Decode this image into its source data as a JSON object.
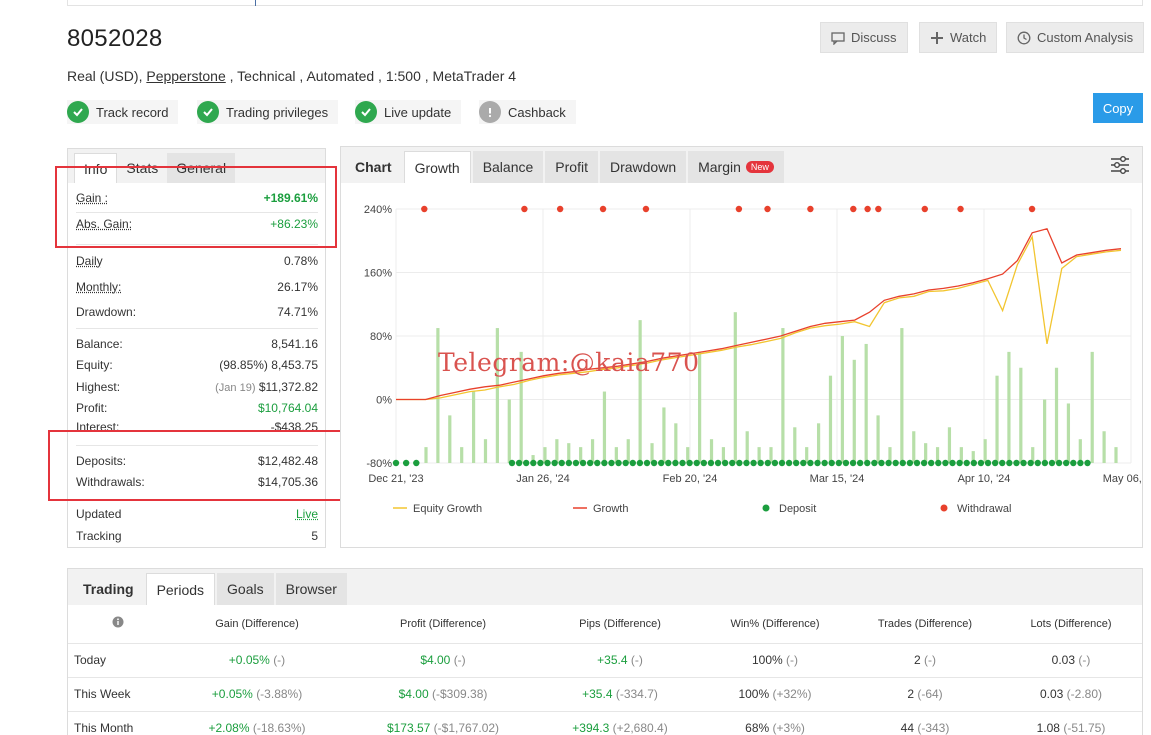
{
  "account": {
    "title": "8052028",
    "meta_prefix": "Real (USD), ",
    "broker": "Pepperstone",
    "meta_suffix": " , Technical , Automated , 1:500 , MetaTrader 4"
  },
  "header_buttons": {
    "discuss": "Discuss",
    "watch": "Watch",
    "custom_analysis": "Custom Analysis",
    "copy": "Copy"
  },
  "badges": [
    {
      "label": "Track record",
      "status": "verified"
    },
    {
      "label": "Trading privileges",
      "status": "verified"
    },
    {
      "label": "Live update",
      "status": "verified"
    },
    {
      "label": "Cashback",
      "status": "unverified"
    }
  ],
  "info_tabs": [
    "Info",
    "Stats",
    "General"
  ],
  "info": {
    "gain_label": "Gain :",
    "gain_value": "+189.61%",
    "abs_gain_label": "Abs. Gain:",
    "abs_gain_value": "+86.23%",
    "daily_label": "Daily",
    "daily_value": "0.78%",
    "monthly_label": "Monthly:",
    "monthly_value": "26.17%",
    "drawdown_label": "Drawdown:",
    "drawdown_value": "74.71%",
    "balance_label": "Balance:",
    "balance_value": "8,541.16",
    "equity_label": "Equity:",
    "equity_pct": "(98.85%)",
    "equity_value": "8,453.75",
    "highest_label": "Highest:",
    "highest_date": "(Jan 19)",
    "highest_value": "$11,372.82",
    "profit_label": "Profit:",
    "profit_value": "$10,764.04",
    "interest_label": "Interest:",
    "interest_value": "-$438.25",
    "deposits_label": "Deposits:",
    "deposits_value": "$12,482.48",
    "withdrawals_label": "Withdrawals:",
    "withdrawals_value": "$14,705.36",
    "updated_label": "Updated",
    "updated_value": "Live",
    "tracking_label": "Tracking",
    "tracking_value": "5"
  },
  "chart_tabs": {
    "label": "Chart",
    "items": [
      "Growth",
      "Balance",
      "Profit",
      "Drawdown",
      "Margin"
    ],
    "new_tag": "New"
  },
  "chart_data": {
    "type": "line",
    "x_tick_labels": [
      "Dec 21, '23",
      "Jan 26, '24",
      "Feb 20, '24",
      "Mar 15, '24",
      "Apr 10, '24",
      "May 06, '24"
    ],
    "y_tick_labels": [
      "240%",
      "160%",
      "80%",
      "0%",
      "-80%"
    ],
    "ylim": [
      -80,
      240
    ],
    "legend_position": "bottom",
    "legend": [
      "Equity Growth",
      "Growth",
      "Deposit",
      "Withdrawal"
    ],
    "colors": {
      "equity": "#f2c530",
      "growth": "#e8412c",
      "bars": "#b7dfa8",
      "deposit": "#1b9e3e",
      "withdrawal": "#e8412c"
    },
    "growth": [
      0,
      0,
      0,
      5,
      9,
      13,
      16,
      18,
      22,
      26,
      30,
      33,
      35,
      38,
      40,
      42,
      45,
      48,
      52,
      55,
      58,
      61,
      64,
      68,
      72,
      76,
      80,
      86,
      92,
      96,
      98,
      100,
      110,
      125,
      130,
      133,
      138,
      140,
      143,
      147,
      152,
      158,
      175,
      210,
      215,
      172,
      182,
      185,
      188,
      190
    ],
    "equity": [
      0,
      0,
      0,
      2,
      6,
      10,
      12,
      16,
      19,
      24,
      28,
      31,
      33,
      35,
      38,
      40,
      43,
      46,
      50,
      53,
      56,
      59,
      62,
      66,
      69,
      73,
      77,
      84,
      90,
      93,
      95,
      98,
      92,
      122,
      128,
      130,
      136,
      137,
      140,
      145,
      150,
      112,
      170,
      205,
      70,
      165,
      180,
      183,
      186,
      188
    ],
    "bars": [
      20,
      170,
      60,
      20,
      90,
      30,
      170,
      80,
      140,
      10,
      20,
      30,
      25,
      20,
      30,
      90,
      20,
      30,
      180,
      25,
      70,
      50,
      20,
      140,
      30,
      20,
      190,
      40,
      20,
      20,
      170,
      45,
      20,
      50,
      110,
      160,
      130,
      150,
      60,
      20,
      170,
      40,
      25,
      20,
      45,
      20,
      15,
      30,
      110,
      140,
      120,
      20,
      80,
      120,
      75,
      30,
      140,
      40,
      20
    ],
    "deposits_count": 85,
    "withdrawals_count": 14
  },
  "watermark": "Telegram:@kaia770",
  "periods": {
    "tabs": [
      "Trading",
      "Periods",
      "Goals",
      "Browser"
    ],
    "columns": [
      "Gain (Difference)",
      "Profit (Difference)",
      "Pips (Difference)",
      "Win% (Difference)",
      "Trades (Difference)",
      "Lots (Difference)"
    ],
    "rows": [
      {
        "label": "Today",
        "gain": "+0.05%",
        "gain_d": "(-)",
        "profit": "$4.00",
        "profit_d": "(-)",
        "pips": "+35.4",
        "pips_d": "(-)",
        "win": "100%",
        "win_d": "(-)",
        "trades": "2",
        "trades_d": "(-)",
        "lots": "0.03",
        "lots_d": "(-)"
      },
      {
        "label": "This Week",
        "gain": "+0.05%",
        "gain_d": "(-3.88%)",
        "profit": "$4.00",
        "profit_d": "(-$309.38)",
        "pips": "+35.4",
        "pips_d": "(-334.7)",
        "win": "100%",
        "win_d": "(+32%)",
        "trades": "2",
        "trades_d": "(-64)",
        "lots": "0.03",
        "lots_d": "(-2.80)"
      },
      {
        "label": "This Month",
        "gain": "+2.08%",
        "gain_d": "(-18.63%)",
        "profit": "$173.57",
        "profit_d": "(-$1,767.02)",
        "pips": "+394.3",
        "pips_d": "(+2,680.4)",
        "win": "68%",
        "win_d": "(+3%)",
        "trades": "44",
        "trades_d": "(-343)",
        "lots": "1.08",
        "lots_d": "(-51.75)"
      }
    ]
  }
}
